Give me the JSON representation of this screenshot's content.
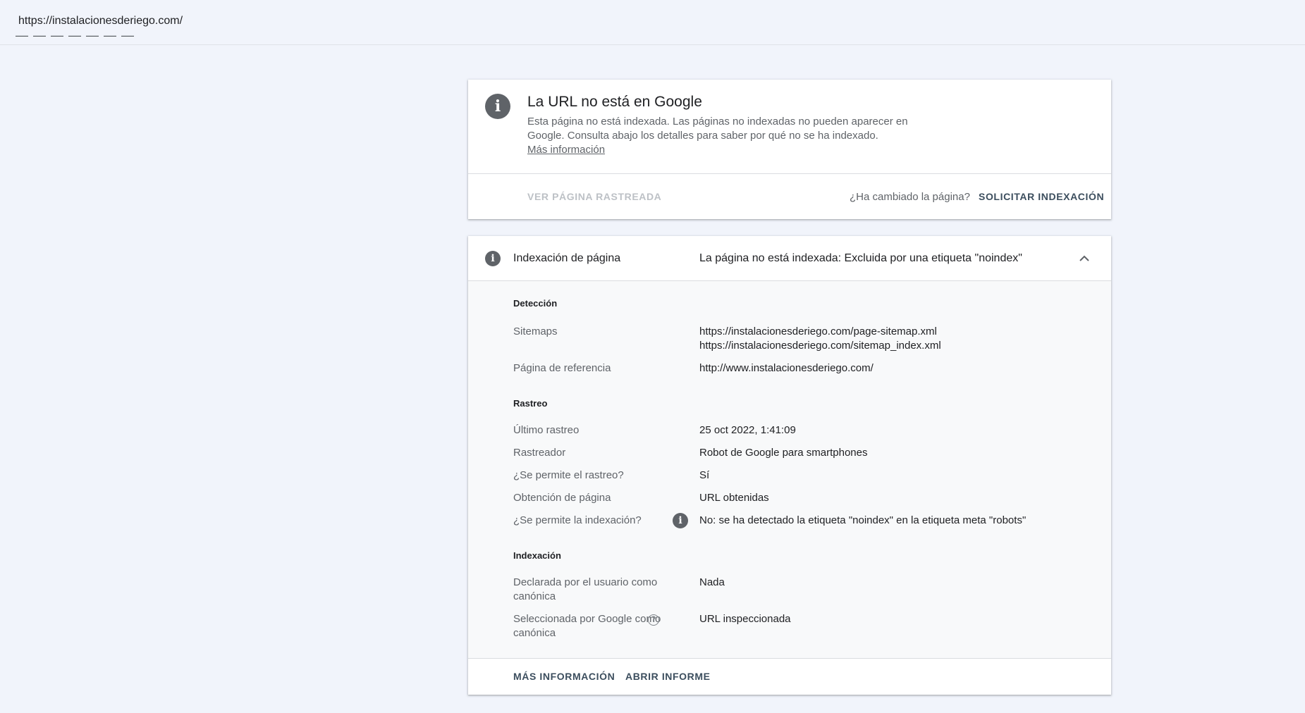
{
  "url_bar": {
    "url": "https://instalacionesderiego.com/"
  },
  "status_card": {
    "title": "La URL no está en Google",
    "description": "Esta página no está indexada. Las páginas no indexadas no pueden aparecer en Google. Consulta abajo los detalles para saber por qué no se ha indexado.",
    "learn_more": "Más información",
    "view_crawled": "VER PÁGINA RASTREADA",
    "changed_question": "¿Ha cambiado la página?",
    "request_indexing": "SOLICITAR INDEXACIÓN"
  },
  "page_indexing": {
    "label": "Indexación de página",
    "value": "La página no está indexada: Excluida por una etiqueta \"noindex\"",
    "sections": {
      "detection": {
        "title": "Detección",
        "sitemaps_label": "Sitemaps",
        "sitemaps": [
          "https://instalacionesderiego.com/page-sitemap.xml",
          "https://instalacionesderiego.com/sitemap_index.xml"
        ],
        "referring_label": "Página de referencia",
        "referring_value": "http://www.instalacionesderiego.com/"
      },
      "crawl": {
        "title": "Rastreo",
        "last_crawl_label": "Último rastreo",
        "last_crawl_value": "25 oct 2022, 1:41:09",
        "crawler_label": "Rastreador",
        "crawler_value": "Robot de Google para smartphones",
        "crawl_allowed_label": "¿Se permite el rastreo?",
        "crawl_allowed_value": "Sí",
        "fetch_label": "Obtención de página",
        "fetch_value": "URL obtenidas",
        "indexing_allowed_label": "¿Se permite la indexación?",
        "indexing_allowed_value": "No: se ha detectado la etiqueta \"noindex\" en la etiqueta meta \"robots\""
      },
      "indexing": {
        "title": "Indexación",
        "user_canonical_label": "Declarada por el usuario como canónica",
        "user_canonical_value": "Nada",
        "google_canonical_label": "Seleccionada por Google como canónica",
        "google_canonical_value": "URL inspeccionada"
      }
    },
    "footer": {
      "more_info": "MÁS INFORMACIÓN",
      "open_report": "ABRIR INFORME"
    }
  },
  "icons": {
    "info": "info-icon",
    "chevron_up": "chevron-up-icon",
    "help": "help-icon"
  },
  "colors": {
    "background": "#f1f4fb",
    "icon_gray": "#5f6368",
    "button_text": "#3c4e5e",
    "disabled_text": "#bdc1c6"
  }
}
